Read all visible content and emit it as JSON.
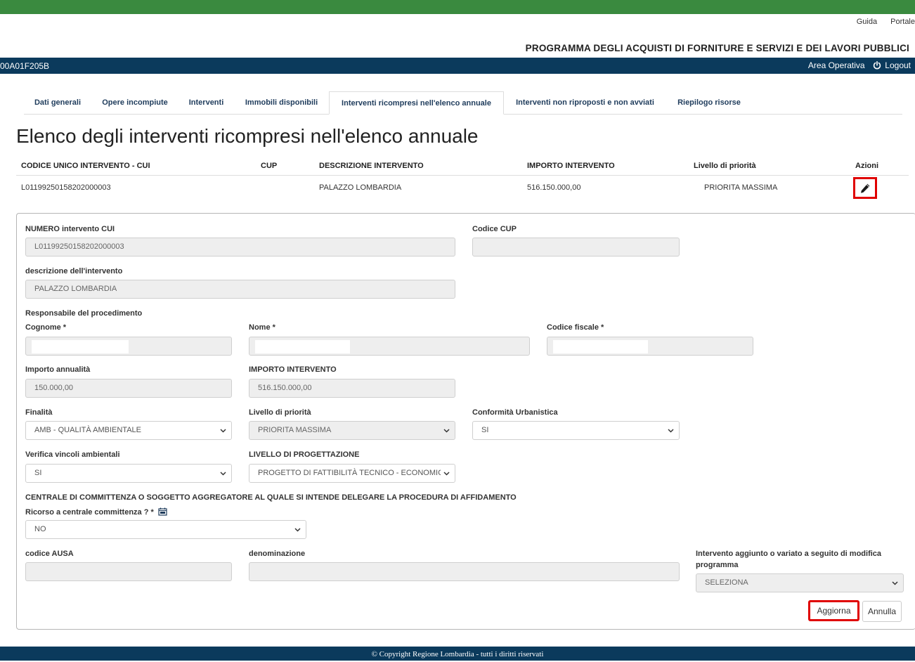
{
  "top_links": {
    "guida": "Guida",
    "portale": "Portale"
  },
  "app_title": "PROGRAMMA DEGLI ACQUISTI DI FORNITURE E SERVIZI E DEI LAVORI PUBBLICI",
  "navbar": {
    "user_id": "00A01F205B",
    "area": "Area Operativa",
    "logout": "Logout"
  },
  "tabs": [
    {
      "label": "Dati generali"
    },
    {
      "label": "Opere incompiute"
    },
    {
      "label": "Interventi"
    },
    {
      "label": "Immobili disponibili"
    },
    {
      "label": "Interventi ricompresi nell'elenco annuale",
      "active": true
    },
    {
      "label": "Interventi non riproposti e non avviati"
    },
    {
      "label": "Riepilogo risorse"
    }
  ],
  "page_title": "Elenco degli interventi ricompresi nell'elenco annuale",
  "table": {
    "headers": {
      "cui": "CODICE UNICO INTERVENTO - CUI",
      "cup": "CUP",
      "descrizione": "DESCRIZIONE INTERVENTO",
      "importo": "IMPORTO INTERVENTO",
      "priorita": "Livello di priorità",
      "azioni": "Azioni"
    },
    "rows": [
      {
        "cui": "L01199250158202000003",
        "cup": "",
        "descrizione": "PALAZZO LOMBARDIA",
        "importo": "516.150.000,00",
        "priorita": "PRIORITA MASSIMA"
      }
    ]
  },
  "form": {
    "numero_cui": {
      "label": "NUMERO intervento CUI",
      "value": "L01199250158202000003"
    },
    "codice_cup": {
      "label": "Codice CUP",
      "value": ""
    },
    "descrizione": {
      "label": "descrizione dell'intervento",
      "value": "PALAZZO LOMBARDIA"
    },
    "responsabile_heading": "Responsabile del procedimento",
    "cognome": {
      "label": "Cognome *"
    },
    "nome": {
      "label": "Nome *"
    },
    "codice_fiscale": {
      "label": "Codice fiscale *"
    },
    "importo_annualita": {
      "label": "Importo annualità",
      "value": "150.000,00"
    },
    "importo_intervento": {
      "label": "IMPORTO INTERVENTO",
      "value": "516.150.000,00"
    },
    "finalita": {
      "label": "Finalità",
      "value": "AMB - QUALITÀ AMBIENTALE"
    },
    "livello_priorita": {
      "label": "Livello di priorità",
      "value": "PRIORITA MASSIMA"
    },
    "conformita": {
      "label": "Conformità Urbanistica",
      "value": "SI"
    },
    "vincoli": {
      "label": "Verifica vincoli ambientali",
      "value": "SI"
    },
    "progettazione": {
      "label": "LIVELLO DI PROGETTAZIONE",
      "value": "PROGETTO DI FATTIBILITÀ TECNICO - ECONOMICA"
    },
    "centrale_heading": "CENTRALE DI COMMITTENZA O SOGGETTO AGGREGATORE AL QUALE SI INTENDE DELEGARE LA PROCEDURA DI AFFIDAMENTO",
    "ricorso": {
      "label": "Ricorso a centrale committenza ? *",
      "value": "NO"
    },
    "codice_ausa": {
      "label": "codice AUSA",
      "value": ""
    },
    "denominazione": {
      "label": "denominazione",
      "value": ""
    },
    "intervento_aggiunto": {
      "label_line1": "Intervento aggiunto o variato a seguito di modifica",
      "label_line2": "programma",
      "value": "SELEZIONA"
    },
    "aggiorna": "Aggiorna",
    "annulla": "Annulla"
  },
  "footer": "© Copyright Regione Lombardia - tutti i diritti riservati",
  "colors": {
    "top_bar": "#3a8a3f",
    "navbar": "#0b3a5c",
    "highlight": "#e00000"
  }
}
